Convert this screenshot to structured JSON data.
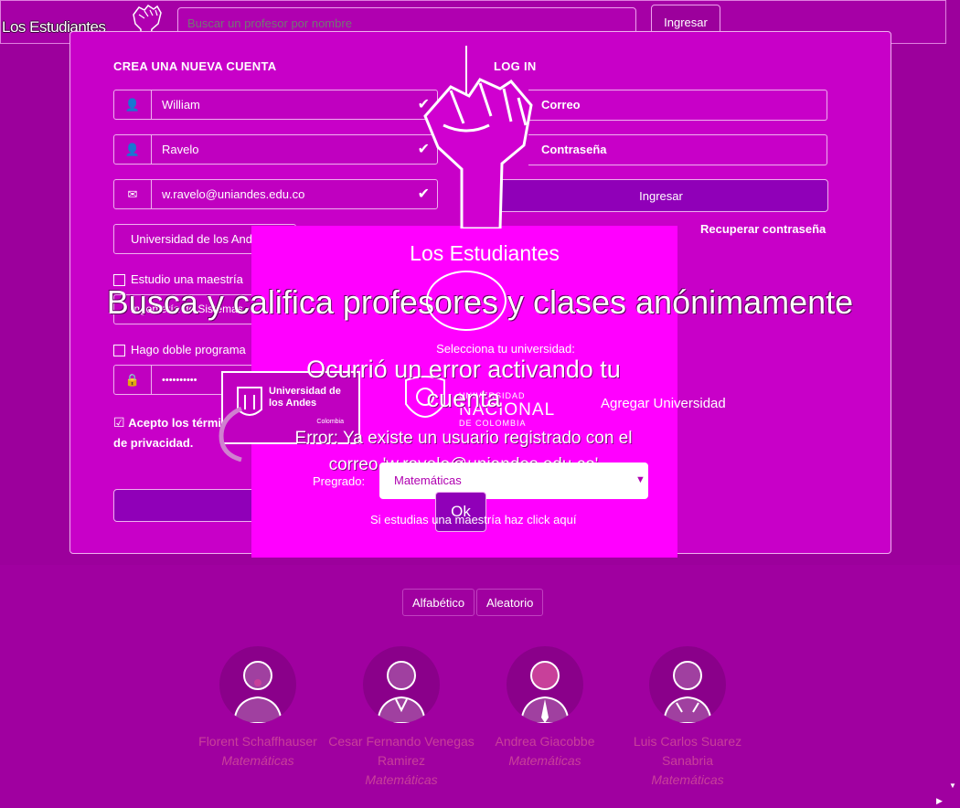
{
  "header": {
    "brand": "Los Estudiantes",
    "search_placeholder": "Buscar un profesor por nombre",
    "login_button": "Ingresar"
  },
  "signup": {
    "title": "CREA UNA NUEVA CUENTA",
    "first_name": "William",
    "last_name": "Ravelo",
    "email": "w.ravelo@uniandes.edu.co",
    "university": "Universidad de los Andes",
    "master_checkbox": "Estudio una maestría",
    "program": "Ingeniería de Sistemas",
    "double_program_checkbox": "Hago doble programa",
    "password": "••••••••••",
    "terms_prefix": "Acepto los términos",
    "terms_suffix": "de privacidad."
  },
  "login": {
    "title": "LOG IN",
    "email_placeholder": "Correo",
    "password_placeholder": "Contraseña",
    "submit": "Ingresar",
    "recover": "Recuperar contraseña"
  },
  "overlay": {
    "brand": "Los Estudiantes",
    "hero": "Busca y califica profesores y clases anónimamente",
    "select_university": "Selecciona tu universidad:",
    "add_university": "Agregar Universidad",
    "andes_logo": "Universidad de los Andes",
    "andes_country": "Colombia",
    "unal_top": "UNIVERSIDAD",
    "unal_main": "NACIONAL",
    "unal_bottom": "DE COLOMBIA",
    "undergrad_label": "Pregrado:",
    "undergrad_value": "Matemáticas",
    "master_link": "Si estudias una maestría haz click aquí"
  },
  "error": {
    "title": "Ocurrió un error activando tu cuenta",
    "message": "Error: Ya existe un usuario registrado con el correo 'w.ravelo@uniandes.edu.co'",
    "ok": "Ok"
  },
  "sort": {
    "alphabetical": "Alfabético",
    "random": "Aleatorio"
  },
  "professors": [
    {
      "name": "Florent Schaffhauser",
      "dept": "Matemáticas"
    },
    {
      "name": "Cesar Fernando Venegas Ramirez",
      "dept": "Matemáticas"
    },
    {
      "name": "Andrea Giacobbe",
      "dept": "Matemáticas"
    },
    {
      "name": "Luis Carlos Suarez Sanabria",
      "dept": "Matemáticas"
    }
  ]
}
